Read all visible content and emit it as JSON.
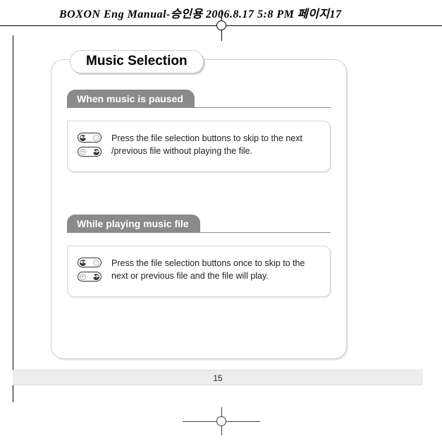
{
  "header": {
    "text": "BOXON Eng Manual-승인용  2006.8.17 5:8 PM  페이지17"
  },
  "panel": {
    "title": "Music Selection",
    "sections": [
      {
        "header": "When music is paused",
        "body": "Press the file selection buttons to skip to the next /previous file without playing the file."
      },
      {
        "header": "While playing music file",
        "body": "Press the file selection buttons once to skip to the next or previous file and the file will play."
      }
    ]
  },
  "footer": {
    "page_number": "15"
  }
}
